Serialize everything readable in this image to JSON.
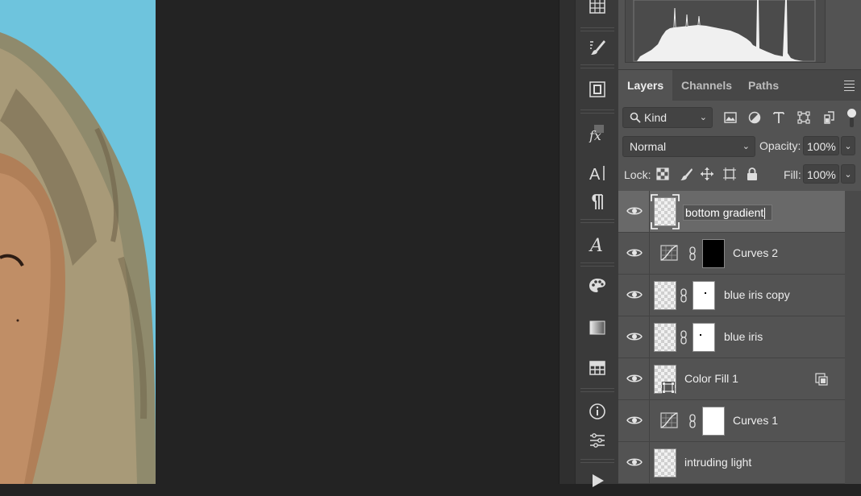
{
  "panel": {
    "tabs": [
      {
        "label": "Layers",
        "active": true
      },
      {
        "label": "Channels",
        "active": false
      },
      {
        "label": "Paths",
        "active": false
      }
    ],
    "filter": {
      "kind_label": "Kind"
    },
    "blend_mode": "Normal",
    "opacity_label": "Opacity:",
    "opacity_value": "100%",
    "lock_label": "Lock:",
    "fill_label": "Fill:",
    "fill_value": "100%"
  },
  "layers": [
    {
      "name": "bottom gradient",
      "type": "pixel",
      "selected": true,
      "editing": true
    },
    {
      "name": "Curves 2",
      "type": "curves",
      "mask": "black"
    },
    {
      "name": "blue iris copy",
      "type": "pixel",
      "mask": "white-dot"
    },
    {
      "name": "blue iris",
      "type": "pixel",
      "mask": "white-dot"
    },
    {
      "name": "Color Fill 1",
      "type": "fill"
    },
    {
      "name": "Curves 1",
      "type": "curves",
      "mask": "white"
    },
    {
      "name": "intruding light",
      "type": "pixel"
    }
  ],
  "toolbar": {
    "icons": [
      "histogram-icon",
      "brush-settings-icon",
      "clone-source-icon",
      "styles-icon",
      "character-icon",
      "paragraph-icon",
      "glyphs-icon",
      "swatches-icon",
      "gradients-icon",
      "patterns-icon",
      "info-icon",
      "adjustments-icon",
      "actions-icon"
    ]
  },
  "colors": {
    "panel_bg": "#535353",
    "selected_layer": "#696969",
    "canvas_bg": "#232323",
    "photo_sky": "#6ec4dd"
  }
}
